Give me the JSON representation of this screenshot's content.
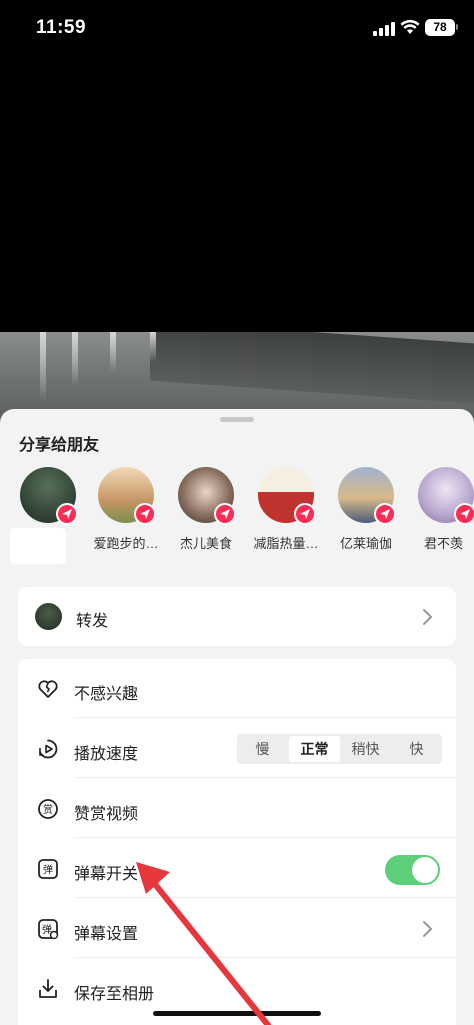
{
  "status_bar": {
    "time": "11:59",
    "battery": "78",
    "signal_icon": "cellular-signal",
    "wifi_icon": "wifi"
  },
  "share_sheet": {
    "title": "分享给朋友",
    "friends": [
      {
        "name": "",
        "avatar_color": "#3b4a3c"
      },
      {
        "name": "爱跑步的…",
        "avatar_color": "#d8b48a"
      },
      {
        "name": "杰儿美食",
        "avatar_color": "#9a8a82"
      },
      {
        "name": "减脂热量…",
        "avatar_color": "#c0322e"
      },
      {
        "name": "亿莱瑜伽",
        "avatar_color": "#6b7fa0"
      },
      {
        "name": "君不羡",
        "avatar_color": "#b6a4cc"
      }
    ],
    "forward": {
      "label": "转发"
    },
    "menu": {
      "not_interested": "不感兴趣",
      "playback_speed": "播放速度",
      "speed_options": [
        "慢",
        "正常",
        "稍快",
        "快"
      ],
      "speed_selected": "正常",
      "tip_video": "赞赏视频",
      "danmaku_toggle": "弹幕开关",
      "danmaku_on": true,
      "danmaku_settings": "弹幕设置",
      "save_to_album": "保存至相册"
    }
  },
  "colors": {
    "accent_red": "#fe2c55",
    "toggle_green": "#5dcf7b",
    "arrow_red": "#e5373c"
  }
}
